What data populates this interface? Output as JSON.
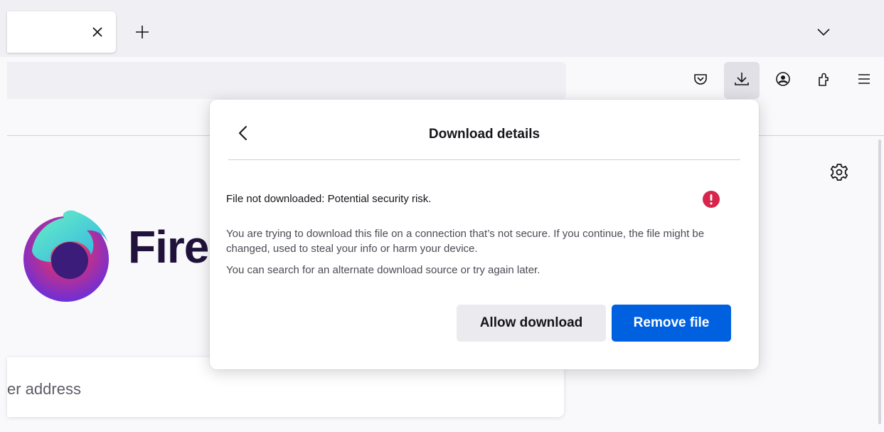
{
  "tabs": {
    "close_icon": "close-icon",
    "new_tab_icon": "plus-icon",
    "list_all_icon": "chevron-down-icon"
  },
  "toolbar": {
    "buttons": [
      "pocket-icon",
      "download-icon",
      "account-icon",
      "extensions-icon",
      "menu-icon"
    ],
    "active_button": "download-icon"
  },
  "newtab_page": {
    "wordmark": "Fire",
    "search_placeholder": "er address",
    "settings_icon": "gear-icon"
  },
  "download_panel": {
    "title": "Download details",
    "warning": "File not downloaded: Potential security risk.",
    "description": "You are trying to download this file on a connection that’s not secure. If you continue, the file might be changed, used to steal your info or harm your device.",
    "suggestion": "You can search for an alternate download source or try again later.",
    "allow_button": "Allow download",
    "remove_button": "Remove file"
  },
  "colors": {
    "primary_button": "#0061e0",
    "alert": "#d7264b",
    "wordmark": "#20123a"
  }
}
